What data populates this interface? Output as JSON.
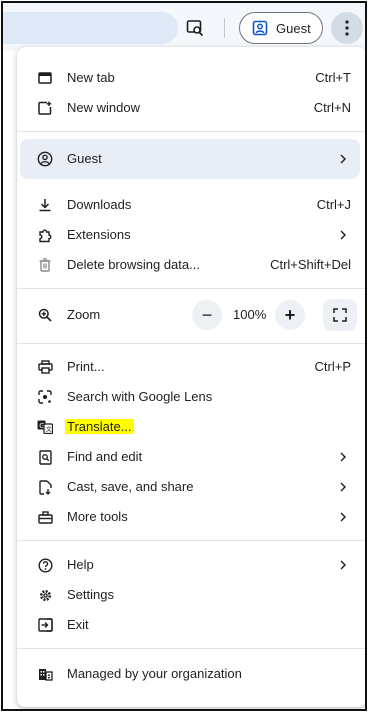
{
  "toolbar": {
    "guest_label": "Guest",
    "icons": [
      "search-page-lens-icon",
      "guest-profile-icon",
      "kebab-menu-icon"
    ]
  },
  "menu": {
    "new_tab": {
      "label": "New tab",
      "shortcut": "Ctrl+T"
    },
    "new_window": {
      "label": "New window",
      "shortcut": "Ctrl+N"
    },
    "guest": {
      "label": "Guest"
    },
    "downloads": {
      "label": "Downloads",
      "shortcut": "Ctrl+J"
    },
    "extensions": {
      "label": "Extensions"
    },
    "delete_data": {
      "label": "Delete browsing data...",
      "shortcut": "Ctrl+Shift+Del"
    },
    "zoom": {
      "label": "Zoom",
      "value": "100%",
      "minus": "−",
      "plus": "+"
    },
    "print": {
      "label": "Print...",
      "shortcut": "Ctrl+P"
    },
    "lens": {
      "label": "Search with Google Lens"
    },
    "translate": {
      "label": "Translate..."
    },
    "find_edit": {
      "label": "Find and edit"
    },
    "cast": {
      "label": "Cast, save, and share"
    },
    "more_tools": {
      "label": "More tools"
    },
    "help": {
      "label": "Help"
    },
    "settings": {
      "label": "Settings"
    },
    "exit": {
      "label": "Exit"
    },
    "managed": {
      "label": "Managed by your organization"
    }
  },
  "colors": {
    "highlight": "#ffff00",
    "guest_row_bg": "#e9eef6",
    "toolbar_bg": "#f4f7fc"
  }
}
